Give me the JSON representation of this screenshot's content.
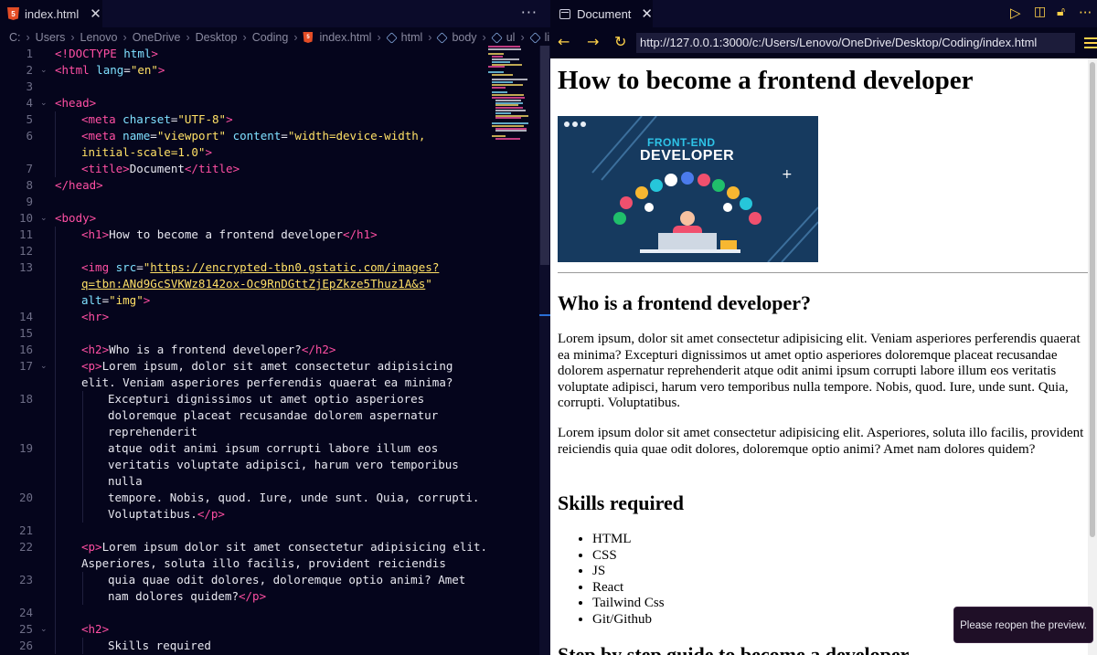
{
  "editor": {
    "tab": {
      "filename": "index.html"
    },
    "more_label": "···",
    "breadcrumb": {
      "parts": [
        "C:",
        "Users",
        "Lenovo",
        "OneDrive",
        "Desktop",
        "Coding"
      ],
      "file": "index.html",
      "symbols": [
        "html",
        "body",
        "ul",
        "li"
      ]
    },
    "lines": [
      {
        "n": "1",
        "indent": 0,
        "html": "<span class=\"t\">&lt;!</span><span class=\"t\">DOCTYPE</span> <span class=\"a\">html</span><span class=\"t\">&gt;</span>"
      },
      {
        "n": "2",
        "indent": 0,
        "fold": true,
        "html": "<span class=\"t\">&lt;html</span> <span class=\"a\">lang</span>=<span class=\"s\">\"en\"</span><span class=\"t\">&gt;</span>"
      },
      {
        "n": "3",
        "indent": 0,
        "html": ""
      },
      {
        "n": "4",
        "indent": 0,
        "fold": true,
        "html": "<span class=\"t\">&lt;head&gt;</span>"
      },
      {
        "n": "5",
        "indent": 1,
        "html": "<span class=\"t\">&lt;meta</span> <span class=\"a\">charset</span>=<span class=\"s\">\"UTF-8\"</span><span class=\"t\">&gt;</span>"
      },
      {
        "n": "6",
        "indent": 1,
        "html": "<span class=\"t\">&lt;meta</span> <span class=\"a\">name</span>=<span class=\"s\">\"viewport\"</span> <span class=\"a\">content</span>=<span class=\"s\">\"width=device-width,</span>"
      },
      {
        "n": "",
        "indent": 1,
        "html": "<span class=\"s\">initial-scale=1.0\"</span><span class=\"t\">&gt;</span>"
      },
      {
        "n": "7",
        "indent": 1,
        "html": "<span class=\"t\">&lt;title&gt;</span>Document<span class=\"t\">&lt;/title&gt;</span>"
      },
      {
        "n": "8",
        "indent": 0,
        "html": "<span class=\"t\">&lt;/head&gt;</span>"
      },
      {
        "n": "9",
        "indent": 0,
        "html": ""
      },
      {
        "n": "10",
        "indent": 0,
        "fold": true,
        "html": "<span class=\"t\">&lt;body&gt;</span>"
      },
      {
        "n": "11",
        "indent": 1,
        "html": "<span class=\"t\">&lt;h1&gt;</span>How to become a frontend developer<span class=\"t\">&lt;/h1&gt;</span>"
      },
      {
        "n": "12",
        "indent": 1,
        "html": ""
      },
      {
        "n": "13",
        "indent": 1,
        "html": "<span class=\"t\">&lt;img</span> <span class=\"a\">src</span>=<span class=\"s\">\"</span><span class=\"u\">https://encrypted-tbn0.gstatic.com/images?</span>"
      },
      {
        "n": "",
        "indent": 1,
        "html": "<span class=\"u\">q=tbn:ANd9GcSVKWz8142ox-Oc9RnDGttZjEpZkze5Thuz1A&amp;s</span><span class=\"s\">\"</span>"
      },
      {
        "n": "",
        "indent": 1,
        "html": "<span class=\"a\">alt</span>=<span class=\"s\">\"img\"</span><span class=\"t\">&gt;</span>"
      },
      {
        "n": "14",
        "indent": 1,
        "html": "<span class=\"t\">&lt;hr&gt;</span>"
      },
      {
        "n": "15",
        "indent": 1,
        "html": ""
      },
      {
        "n": "16",
        "indent": 1,
        "html": "<span class=\"t\">&lt;h2&gt;</span>Who is a frontend developer?<span class=\"t\">&lt;/h2&gt;</span>"
      },
      {
        "n": "17",
        "indent": 1,
        "fold": true,
        "html": "<span class=\"t\">&lt;p&gt;</span>Lorem ipsum, dolor sit amet consectetur adipisicing"
      },
      {
        "n": "",
        "indent": 1,
        "html": "elit. Veniam asperiores perferendis quaerat ea minima?"
      },
      {
        "n": "18",
        "indent": 2,
        "html": "Excepturi dignissimos ut amet optio asperiores"
      },
      {
        "n": "",
        "indent": 2,
        "html": "doloremque placeat recusandae dolorem aspernatur"
      },
      {
        "n": "",
        "indent": 2,
        "html": "reprehenderit"
      },
      {
        "n": "19",
        "indent": 2,
        "html": "atque odit animi ipsum corrupti labore illum eos"
      },
      {
        "n": "",
        "indent": 2,
        "html": "veritatis voluptate adipisci, harum vero temporibus"
      },
      {
        "n": "",
        "indent": 2,
        "html": "nulla"
      },
      {
        "n": "20",
        "indent": 2,
        "html": "tempore. Nobis, quod. Iure, unde sunt. Quia, corrupti."
      },
      {
        "n": "",
        "indent": 2,
        "html": "Voluptatibus.<span class=\"t\">&lt;/p&gt;</span>"
      },
      {
        "n": "21",
        "indent": 1,
        "html": ""
      },
      {
        "n": "22",
        "indent": 1,
        "html": "<span class=\"t\">&lt;p&gt;</span>Lorem ipsum dolor sit amet consectetur adipisicing elit."
      },
      {
        "n": "",
        "indent": 1,
        "html": "Asperiores, soluta illo facilis, provident reiciendis"
      },
      {
        "n": "23",
        "indent": 2,
        "html": "quia quae odit dolores, doloremque optio animi? Amet"
      },
      {
        "n": "",
        "indent": 2,
        "html": "nam dolores quidem?<span class=\"t\">&lt;/p&gt;</span>"
      },
      {
        "n": "24",
        "indent": 1,
        "html": ""
      },
      {
        "n": "25",
        "indent": 1,
        "fold": true,
        "html": "<span class=\"t\">&lt;h2&gt;</span>"
      },
      {
        "n": "26",
        "indent": 2,
        "html": "Skills required"
      }
    ]
  },
  "preview": {
    "tab_title": "Document",
    "url": "http://127.0.0.1:3000/c:/Users/Lenovo/OneDrive/Desktop/Coding/index.html",
    "toast": "Please reopen the preview.",
    "page": {
      "h1": "How to become a frontend developer",
      "hero_line1": "FRONT-END",
      "hero_line2": "DEVELOPER",
      "h2_who": "Who is a frontend developer?",
      "p1": "Lorem ipsum, dolor sit amet consectetur adipisicing elit. Veniam asperiores perferendis quaerat ea minima? Excepturi dignissimos ut amet optio asperiores doloremque placeat recusandae dolorem aspernatur reprehenderit atque odit animi ipsum corrupti labore illum eos veritatis voluptate adipisci, harum vero temporibus nulla tempore. Nobis, quod. Iure, unde sunt. Quia, corrupti. Voluptatibus.",
      "p2": "Lorem ipsum dolor sit amet consectetur adipisicing elit. Asperiores, soluta illo facilis, provident reiciendis quia quae odit dolores, doloremque optio animi? Amet nam dolores quidem?",
      "h2_skills": "Skills required",
      "skills": [
        "HTML",
        "CSS",
        "JS",
        "React",
        "Tailwind Css",
        "Git/Github"
      ],
      "h2_steps": "Step by step guide to become a developer"
    }
  },
  "colors": {
    "editor_bg": "#05051c",
    "tag": "#ff4fa3",
    "attr": "#7fe0ff",
    "string": "#ffe066",
    "preview_toolbar_icons": "#ffd24a"
  }
}
